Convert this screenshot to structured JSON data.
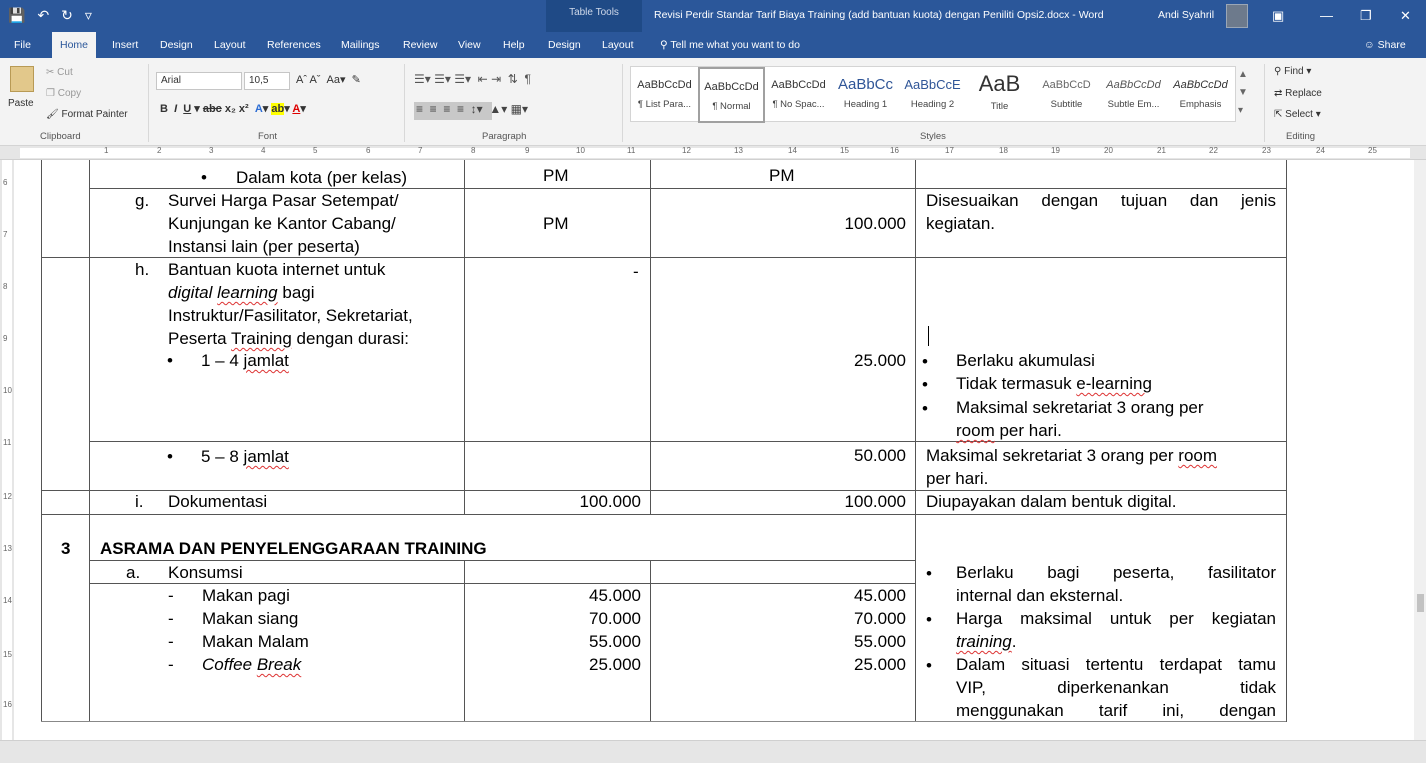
{
  "titlebar": {
    "table_tools": "Table Tools",
    "doc_title": "Revisi Perdir Standar Tarif Biaya Training (add bantuan kuota) dengan Peniliti Opsi2.docx  -  Word",
    "user": "Andi Syahril"
  },
  "tabs": [
    "File",
    "Home",
    "Insert",
    "Design",
    "Layout",
    "References",
    "Mailings",
    "Review",
    "View",
    "Help",
    "Design",
    "Layout"
  ],
  "tell_me": "Tell me what you want to do",
  "share": "Share",
  "clipboard": {
    "paste": "Paste",
    "cut": "Cut",
    "copy": "Copy",
    "format_painter": "Format Painter",
    "label": "Clipboard"
  },
  "font": {
    "name": "Arial",
    "size": "10,5",
    "label": "Font"
  },
  "paragraph": {
    "label": "Paragraph"
  },
  "styles": {
    "label": "Styles",
    "items": [
      {
        "preview": "AaBbCcDd",
        "name": "¶ List Para..."
      },
      {
        "preview": "AaBbCcDd",
        "name": "¶ Normal"
      },
      {
        "preview": "AaBbCcDd",
        "name": "¶ No Spac..."
      },
      {
        "preview": "AaBbCc",
        "name": "Heading 1"
      },
      {
        "preview": "AaBbCcE",
        "name": "Heading 2"
      },
      {
        "preview": "AaB",
        "name": "Title"
      },
      {
        "preview": "AaBbCcD",
        "name": "Subtitle"
      },
      {
        "preview": "AaBbCcDd",
        "name": "Subtle Em..."
      },
      {
        "preview": "AaBbCcDd",
        "name": "Emphasis"
      }
    ]
  },
  "editing": {
    "find": "Find",
    "replace": "Replace",
    "select": "Select",
    "label": "Editing"
  },
  "ruler": [
    "1",
    "2",
    "3",
    "4",
    "5",
    "6",
    "7",
    "8",
    "9",
    "10",
    "11",
    "12",
    "13",
    "14",
    "15",
    "16",
    "17",
    "18",
    "19",
    "20",
    "21",
    "22",
    "23",
    "24",
    "25"
  ],
  "vruler": [
    "6",
    "7",
    "8",
    "9",
    "10",
    "11",
    "12",
    "13",
    "14",
    "15",
    "16"
  ],
  "doc": {
    "row_f_item": "Dalam kota (per kelas)",
    "row_f_c1": "PM",
    "row_f_c2": "PM",
    "g_letter": "g.",
    "g_line1": "Survei Harga Pasar Setempat/",
    "g_line2": "Kunjungan ke Kantor Cabang/",
    "g_line3": "Instansi lain (per peserta)",
    "g_c1": "PM",
    "g_c2": "100.000",
    "g_note1": "Disesuaikan dengan tujuan dan jenis",
    "g_note2": "kegiatan.",
    "h_letter": "h.",
    "h_line1": "Bantuan kuota internet untuk",
    "h_line2a": "digital ",
    "h_line2b": "learning",
    "h_line2c": " bagi",
    "h_line3": "Instruktur/Fasilitator, Sekretariat,",
    "h_line4a": "Peserta ",
    "h_line4b": "Training",
    "h_line4c": " dengan durasi:",
    "h_sub1a": "1 – 4 ",
    "h_sub1b": "jamlat",
    "h_c1": "-",
    "h_c2": "25.000",
    "h_note1": "Berlaku akumulasi",
    "h_note2a": "Tidak termasuk ",
    "h_note2b": "e-learning",
    "h_note3": "Maksimal sekretariat 3 orang per",
    "h_note3b": "room",
    "h_note3c": " per hari.",
    "h5_sub_a": "5 – 8 ",
    "h5_sub_b": "jamlat",
    "h5_c2": "50.000",
    "h5_note1a": "Maksimal sekretariat 3 orang per ",
    "h5_note1b": "room",
    "h5_note2": "per hari.",
    "i_letter": "i.",
    "i_item": "Dokumentasi",
    "i_c1": "100.000",
    "i_c2": "100.000",
    "i_note": "Diupayakan dalam bentuk digital.",
    "s3_num": "3",
    "s3_title": "ASRAMA DAN PENYELENGGARAAN TRAINING",
    "a_letter": "a.",
    "a_item": "Konsumsi",
    "meals": [
      {
        "name": "Makan pagi",
        "c1": "45.000",
        "c2": "45.000"
      },
      {
        "name": "Makan siang",
        "c1": "70.000",
        "c2": "70.000"
      },
      {
        "name": "Makan Malam",
        "c1": "55.000",
        "c2": "55.000"
      },
      {
        "name_a": "Coffee ",
        "name_b": "Break",
        "c1": "25.000",
        "c2": "25.000"
      }
    ],
    "a_note1": "Berlaku bagi peserta, fasilitator",
    "a_note1b": "internal dan eksternal.",
    "a_note2": "Harga maksimal untuk per kegiatan",
    "a_note2b": "training",
    ".": ".",
    "a_note3": "Dalam situasi tertentu terdapat tamu",
    "a_note3b": "VIP, diperkenankan tidak",
    "a_note3c": "menggunakan tarif ini, dengan",
    "dash": "-",
    "bullet": "•"
  }
}
